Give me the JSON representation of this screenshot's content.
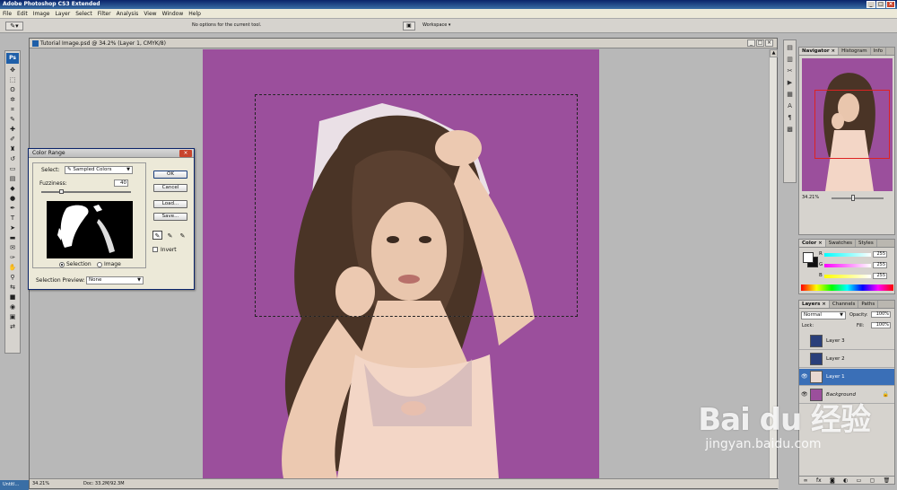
{
  "app": {
    "title": "Adobe Photoshop CS3 Extended"
  },
  "menu": [
    "File",
    "Edit",
    "Image",
    "Layer",
    "Select",
    "Filter",
    "Analysis",
    "View",
    "Window",
    "Help"
  ],
  "options_bar": {
    "message": "No options for the current tool.",
    "workspace": "Workspace ▾"
  },
  "document": {
    "title": "Tutorial Image.psd @ 34.2% (Layer 1, CMYK/8)",
    "zoom": "34.21%",
    "doc_info": "Doc: 33.2M/92.3M",
    "canvas_color": "#9b4f9c"
  },
  "color_range": {
    "title": "Color Range",
    "select_label": "Select:",
    "select_value": "Sampled Colors",
    "fuzziness_label": "Fuzziness:",
    "fuzziness_value": "40",
    "fuzziness_level": 0.2,
    "radio_selection": "Selection",
    "radio_image": "Image",
    "preview_label": "Selection Preview:",
    "preview_value": "None",
    "buttons": {
      "ok": "OK",
      "cancel": "Cancel",
      "load": "Load...",
      "save": "Save..."
    },
    "invert_label": "Invert"
  },
  "navigator": {
    "tabs": [
      "Navigator ×",
      "Histogram",
      "Info"
    ],
    "zoom": "34.21%"
  },
  "color_panel": {
    "tabs": [
      "Color ×",
      "Swatches",
      "Styles"
    ],
    "channels": [
      {
        "label": "R",
        "value": "255",
        "gradient": "linear-gradient(90deg,#00ffff,#ffffff)"
      },
      {
        "label": "G",
        "value": "255",
        "gradient": "linear-gradient(90deg,#ff00ff,#ffffff)"
      },
      {
        "label": "B",
        "value": "255",
        "gradient": "linear-gradient(90deg,#ffff00,#ffffff)"
      }
    ]
  },
  "layers_panel": {
    "tabs": [
      "Layers ×",
      "Channels",
      "Paths"
    ],
    "blend_mode": "Normal",
    "opacity_label": "Opacity:",
    "opacity_value": "100%",
    "lock_label": "Lock:",
    "fill_label": "Fill:",
    "fill_value": "100%",
    "layers": [
      {
        "name": "Layer 3",
        "visible": false,
        "thumb": "#2a3f7a",
        "active": false
      },
      {
        "name": "Layer 2",
        "visible": false,
        "thumb": "#2a3f7a",
        "active": false
      },
      {
        "name": "Layer 1",
        "visible": true,
        "thumb": "#e8d8d0",
        "active": true
      },
      {
        "name": "Background",
        "visible": true,
        "thumb": "#9b4f9c",
        "active": false
      }
    ]
  },
  "watermark": {
    "top": "Bai du 经验",
    "bottom": "jingyan.baidu.com"
  },
  "taskbar": {
    "label": "Untitl..."
  }
}
